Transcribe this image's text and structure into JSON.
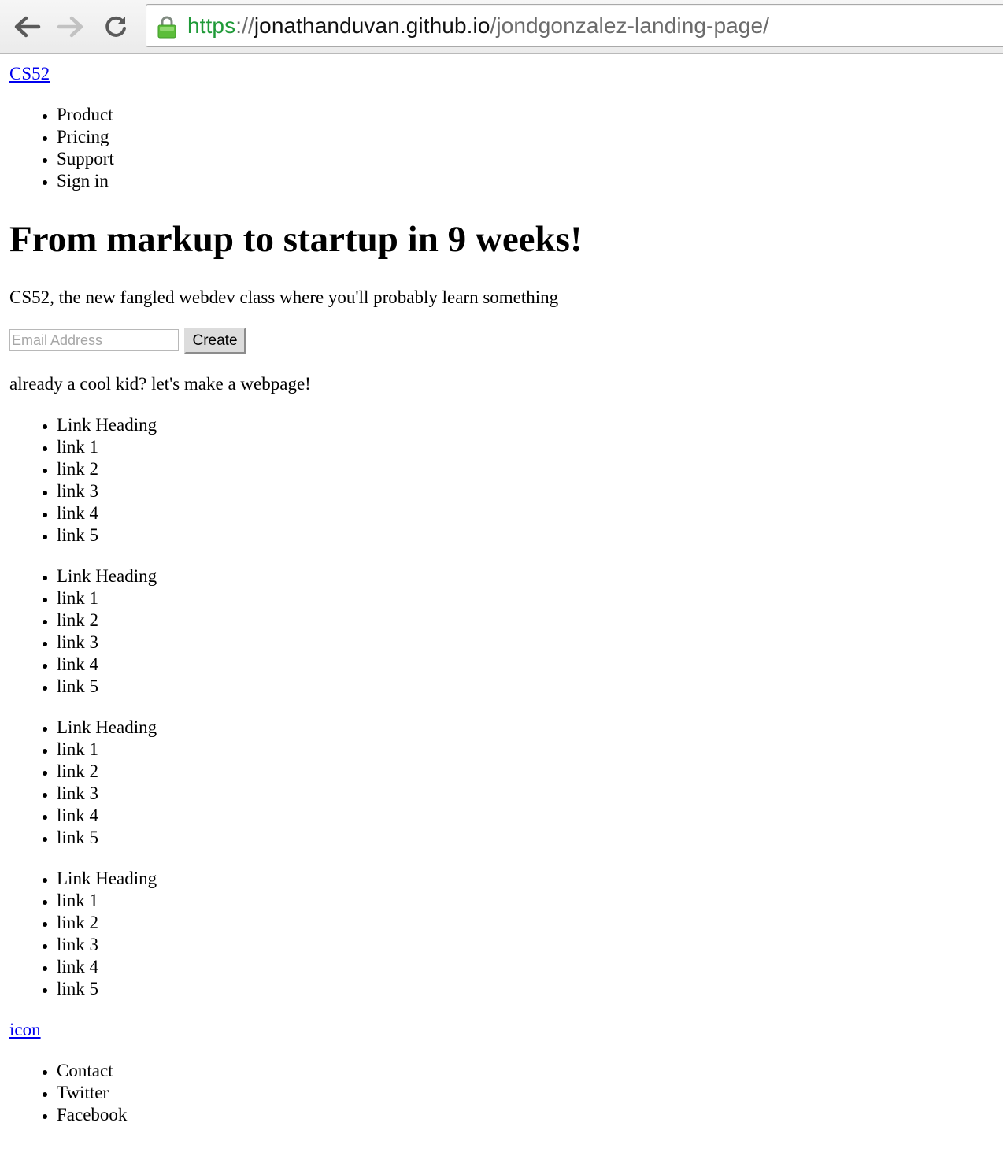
{
  "browser": {
    "url_scheme": "https",
    "url_separator": "://",
    "url_host": "jonathanduvan.github.io",
    "url_path": "/jondgonzalez-landing-page/"
  },
  "header": {
    "brand": "CS52",
    "nav": [
      "Product",
      "Pricing",
      "Support",
      "Sign in"
    ]
  },
  "hero": {
    "title": "From markup to startup in 9 weeks!",
    "subtitle": "CS52, the new fangled webdev class where you'll probably learn something",
    "email_placeholder": "Email Address",
    "create_label": "Create",
    "cool_kid": "already a cool kid? let's make a webpage!"
  },
  "link_columns": [
    {
      "heading": "Link Heading",
      "links": [
        "link 1",
        "link 2",
        "link 3",
        "link 4",
        "link 5"
      ]
    },
    {
      "heading": "Link Heading",
      "links": [
        "link 1",
        "link 2",
        "link 3",
        "link 4",
        "link 5"
      ]
    },
    {
      "heading": "Link Heading",
      "links": [
        "link 1",
        "link 2",
        "link 3",
        "link 4",
        "link 5"
      ]
    },
    {
      "heading": "Link Heading",
      "links": [
        "link 1",
        "link 2",
        "link 3",
        "link 4",
        "link 5"
      ]
    }
  ],
  "footer": {
    "icon_link": "icon",
    "links": [
      "Contact",
      "Twitter",
      "Facebook"
    ]
  },
  "colors": {
    "link": "#0000ee",
    "secure_scheme": "#1f9a38"
  },
  "icons": [
    "back-arrow-icon",
    "forward-arrow-icon",
    "reload-icon",
    "lock-icon"
  ]
}
